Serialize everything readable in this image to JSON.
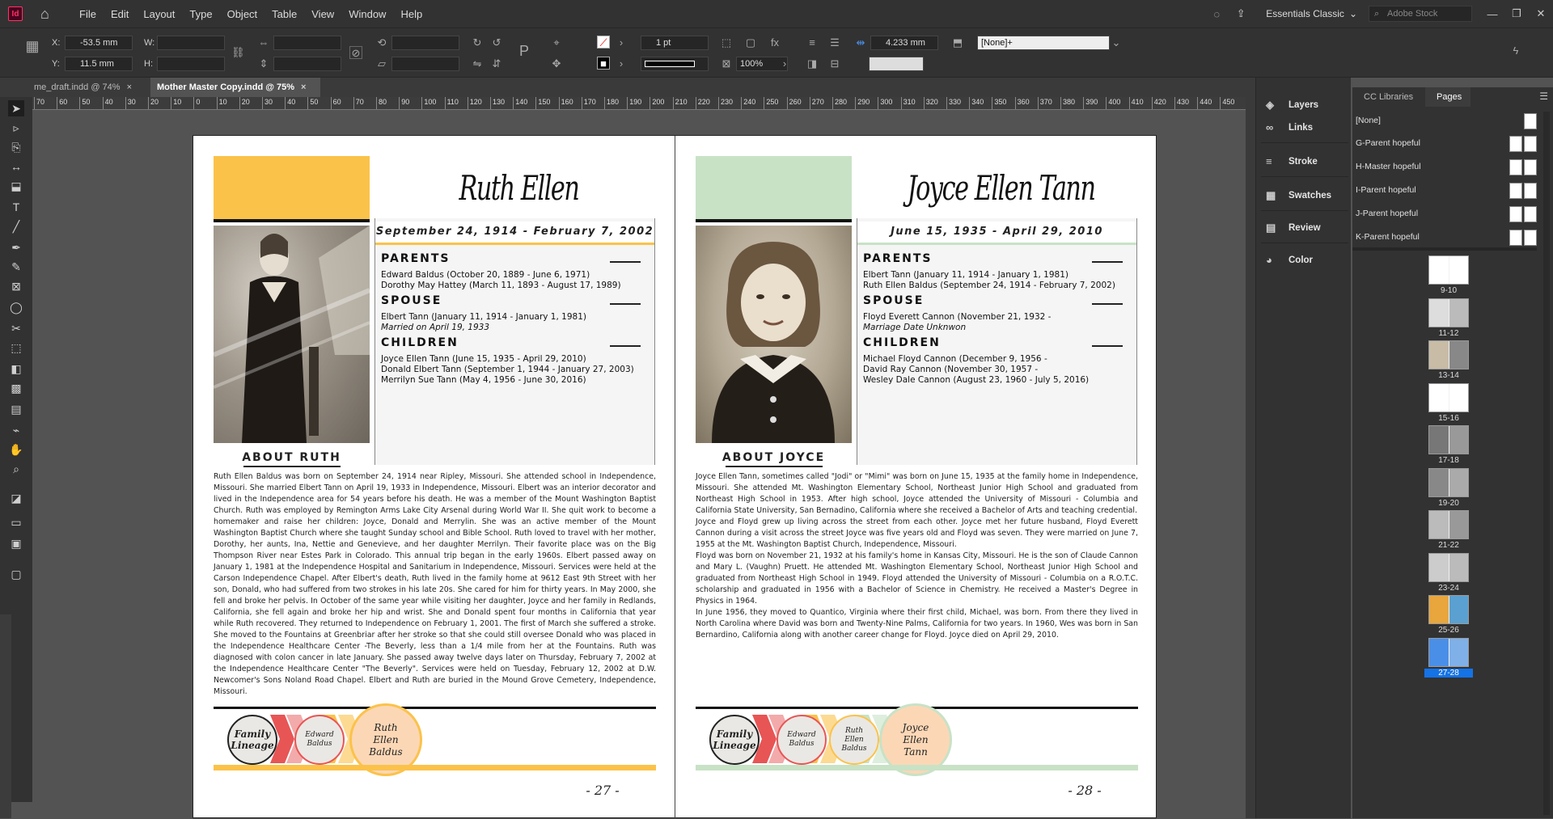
{
  "app": {
    "logo": "Id"
  },
  "menu": [
    "File",
    "Edit",
    "Layout",
    "Type",
    "Object",
    "Table",
    "View",
    "Window",
    "Help"
  ],
  "workspace": "Essentials Classic",
  "stock_placeholder": "Adobe Stock",
  "control": {
    "x_label": "X:",
    "x_value": "-53.5 mm",
    "y_label": "Y:",
    "y_value": "11.5 mm",
    "w_label": "W:",
    "h_label": "H:",
    "stroke_weight": "1 pt",
    "opacity": "100%",
    "gutter": "4.233 mm",
    "object_style": "[None]+"
  },
  "tabs": [
    {
      "label": "me_draft.indd @ 74%",
      "close": "×"
    },
    {
      "label": "Mother Master Copy.indd @ 75%",
      "close": "×"
    }
  ],
  "ruler_ticks": [
    "70",
    "60",
    "50",
    "40",
    "30",
    "20",
    "10",
    "0",
    "10",
    "20",
    "30",
    "40",
    "50",
    "60",
    "70",
    "80",
    "90",
    "100",
    "110",
    "120",
    "130",
    "140",
    "150",
    "160",
    "170",
    "180",
    "190",
    "200",
    "210",
    "220",
    "230",
    "240",
    "250",
    "260",
    "270",
    "280",
    "290",
    "300",
    "310",
    "320",
    "330",
    "340",
    "350",
    "360",
    "370",
    "380",
    "390",
    "400",
    "410",
    "420",
    "430",
    "440",
    "450"
  ],
  "left_page": {
    "name": "Ruth Ellen Baldus",
    "dates": "September 24, 1914 - February 7, 2002",
    "accent": "#fbc24a",
    "parents_head": "PARENTS",
    "parents": [
      "Edward Baldus (October 20, 1889 - June 6, 1971)",
      "Dorothy May Hattey (March 11, 1893 - August 17, 1989)"
    ],
    "spouse_head": "SPOUSE",
    "spouse": [
      "Elbert Tann (January 11, 1914 - January 1, 1981)"
    ],
    "spouse_note": "Married on April 19, 1933",
    "children_head": "CHILDREN",
    "children": [
      "Joyce Ellen Tann (June 15, 1935 - April 29, 2010)",
      "Donald Elbert Tann (September 1, 1944 - January 27, 2003)",
      "Merrilyn Sue Tann (May 4, 1956 - June 30, 2016)"
    ],
    "about_head": "ABOUT RUTH",
    "about": "Ruth Ellen Baldus was born on September 24, 1914 near Ripley, Missouri. She attended school in Independence, Missouri. She married Elbert Tann on April 19, 1933 in Independence, Missouri. Elbert was an interior decorator and lived in the Independence area for 54 years before his death. He was a member of the Mount Washington Baptist Church. Ruth was employed by Remington Arms Lake City Arsenal during World War II. She quit work to become a homemaker and raise her children: Joyce, Donald and Merrylin. She was an active member of the Mount Washington Baptist Church where she taught Sunday school and Bible School. Ruth loved to travel with her mother, Dorothy, her aunts, Ina, Nettie and Genevieve, and her daughter Merrilyn. Their favorite place was on the Big Thompson River near Estes Park in Colorado. This annual trip began in the early 1960s. Elbert passed away on January 1, 1981 at the Independence Hospital and Sanitarium in Independence, Missouri. Services were held at the Carson Independence Chapel. After Elbert's death, Ruth lived in the family home at 9612 East 9th Street with her son, Donald, who had suffered from two strokes in his late 20s. She cared for him for thirty years. In May 2000, she fell and broke her pelvis. In October of the same year while visiting her daughter, Joyce and her family in Redlands, California, she fell again and broke her hip and wrist. She and Donald spent four months in California that year while Ruth recovered. They returned to Independence on February 1, 2001. The first of March she suffered a stroke. She moved to the Fountains at Greenbriar after her stroke so that she could still oversee Donald who was placed in the Independence Healthcare Center -The Beverly, less than a 1/4 mile from her at the Fountains. Ruth was diagnosed with colon cancer in late January. She passed away twelve days later on Thursday, February 7, 2002 at the Independence Healthcare Center \"The Beverly\". Services were held on Tuesday, February 12, 2002 at D.W. Newcomer's Sons Noland Road Chapel. Elbert and Ruth are buried in the Mound Grove Cemetery, Independence, Missouri.",
    "lineage": [
      "Family Lineage",
      "Edward Baldus",
      "Ruth Ellen Baldus"
    ],
    "page_number": "- 27 -"
  },
  "right_page": {
    "name": "Joyce Ellen Tann",
    "dates": "June 15, 1935 - April 29, 2010",
    "accent": "#c8e2c6",
    "parents_head": "PARENTS",
    "parents": [
      "Elbert Tann (January 11, 1914 - January 1, 1981)",
      "Ruth Ellen Baldus (September 24, 1914 - February 7, 2002)"
    ],
    "spouse_head": "SPOUSE",
    "spouse": [
      "Floyd Everett Cannon (November 21, 1932 -"
    ],
    "spouse_note": "Marriage Date Unknwon",
    "children_head": "CHILDREN",
    "children": [
      "Michael Floyd Cannon (December 9, 1956 -",
      "David Ray Cannon (November 30, 1957 -",
      "Wesley Dale Cannon (August 23, 1960 -  July 5, 2016)"
    ],
    "about_head": "ABOUT JOYCE",
    "about": "Joyce Ellen Tann, sometimes called \"Jodi\" or \"Mimi\" was born on June 15, 1935 at the family home in Independence, Missouri. She attended Mt. Washington Elementary School, Northeast Junior High School and graduated from Northeast High School in 1953. After high school, Joyce attended the University of Missouri - Columbia and California State University, San Bernadino, California where she received a Bachelor of Arts and teaching credential.\nJoyce and Floyd grew up living across the street from each other. Joyce met her future husband, Floyd Everett Cannon during a visit across the street Joyce was five years old and Floyd was seven. They were married on June 7, 1955 at the Mt. Washington Baptist Church, Independence, Missouri.\nFloyd was born on November 21, 1932 at his family's home in Kansas City, Missouri. He is the son of Claude Cannon and Mary L. (Vaughn) Pruett. He attended Mt. Washington Elementary School, Northeast Junior High School and graduated from Northeast High School in 1949. Floyd attended the University of Missouri - Columbia on a R.O.T.C. scholarship and graduated in 1956 with a Bachelor of Science in Chemistry. He received a Master's Degree in Physics in 1964.\nIn June 1956, they moved to Quantico, Virginia where their first child, Michael, was born. From there they lived in North Carolina where David was born and Twenty-Nine Palms, California for two years. In 1960, Wes was born in San Bernardino, California along with another career change for Floyd. Joyce died on April 29, 2010.",
    "lineage": [
      "Family Lineage",
      "Edward Baldus",
      "Ruth Ellen Baldus",
      "Joyce Ellen Tann"
    ],
    "page_number": "- 28 -"
  },
  "dock": [
    "Layers",
    "Links",
    "Stroke",
    "Swatches",
    "Review",
    "Color"
  ],
  "pages_panel": {
    "tabs": [
      "CC Libraries",
      "Pages"
    ],
    "masters": [
      "[None]",
      "G-Parent hopeful",
      "H-Master hopeful",
      "I-Parent hopeful",
      "J-Parent hopeful",
      "K-Parent hopeful"
    ],
    "spreads": [
      "9-10",
      "11-12",
      "13-14",
      "15-16",
      "17-18",
      "19-20",
      "21-22",
      "23-24",
      "25-26",
      "27-28"
    ],
    "active_spread": "27-28"
  }
}
